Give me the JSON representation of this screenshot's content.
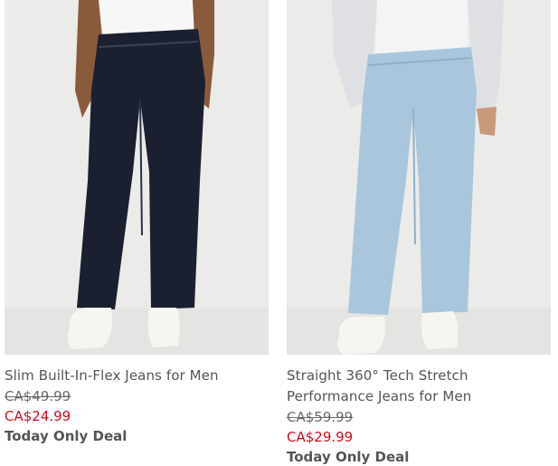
{
  "products": [
    {
      "image_alt": "",
      "title": "Slim Built-In-Flex Jeans for Men",
      "original_price": "CA$49.99",
      "sale_price": "CA$24.99",
      "deal_label": "Today Only Deal",
      "colors": {
        "denim": "#1b2030",
        "shirt": "#f6f6f6",
        "skin": "#8a5a3c"
      }
    },
    {
      "image_alt": "",
      "title": "Straight 360° Tech Stretch Performance Jeans for Men",
      "original_price": "CA$59.99",
      "sale_price": "CA$29.99",
      "deal_label": "Today Only Deal",
      "colors": {
        "denim": "#a9c6dc",
        "shirt": "#f3f3f3",
        "skin": "#c89a7a"
      }
    }
  ],
  "colors": {
    "sale": "#cc0d1c",
    "text": "#555555",
    "image_bg": "#ebebe9"
  }
}
